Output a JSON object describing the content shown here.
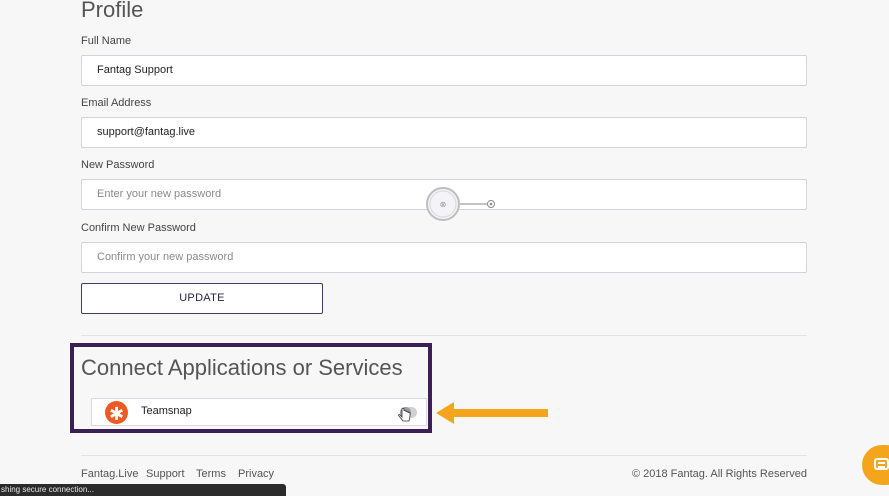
{
  "profile": {
    "title": "Profile",
    "full_name": {
      "label": "Full Name",
      "value": "Fantag Support"
    },
    "email": {
      "label": "Email Address",
      "value": "support@fantag.live"
    },
    "new_password": {
      "label": "New Password",
      "placeholder": "Enter your new password"
    },
    "confirm_password": {
      "label": "Confirm New Password",
      "placeholder": "Confirm your new password"
    },
    "update_label": "UPDATE"
  },
  "connect": {
    "title": "Connect Applications or Services",
    "services": [
      {
        "name": "Teamsnap",
        "icon": "asterisk-icon",
        "enabled": false,
        "brand_color": "#ef5a24"
      }
    ],
    "highlight_color": "#3b1f55",
    "arrow_color": "#f5a51c"
  },
  "footer": {
    "links": [
      "Fantag.Live",
      "Support",
      "Terms",
      "Privacy"
    ],
    "copyright": "© 2018 Fantag. All Rights Reserved"
  },
  "status_bar": {
    "text": "shing secure connection..."
  },
  "colors": {
    "accent": "#3b1f55",
    "chat_bubble": "#f5a51c",
    "background": "#f7f7f8"
  }
}
